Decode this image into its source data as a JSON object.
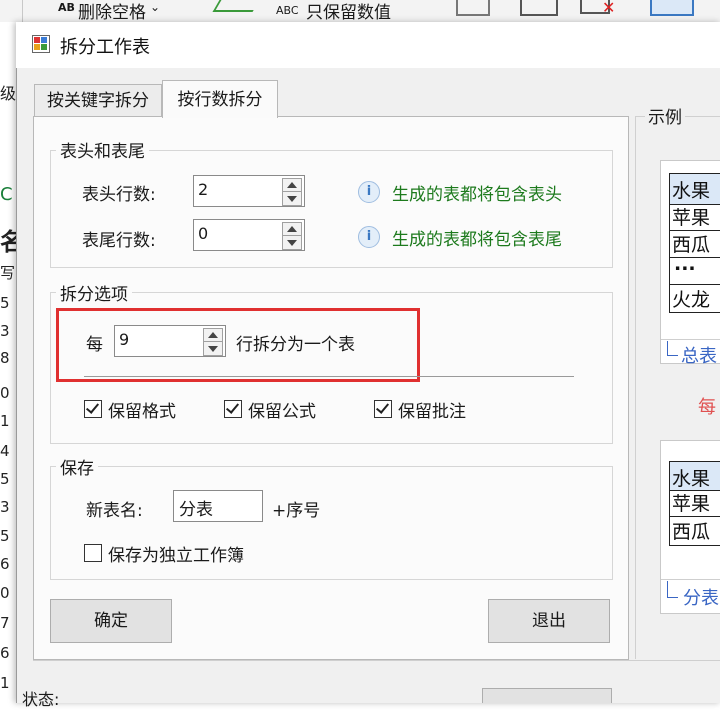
{
  "background": {
    "ribbon": {
      "delete_spaces": "删除空格",
      "keep_values": "只保留数值",
      "ab_prefix": "AB",
      "abc_prefix": "ABC"
    },
    "left_column": [
      "级",
      "C",
      "名",
      "写",
      "5",
      "3",
      "8",
      "0",
      "1",
      "4",
      "5",
      "3",
      "5",
      "6",
      "0",
      "7",
      "6",
      "1"
    ]
  },
  "dialog": {
    "title": "拆分工作表",
    "tabs": [
      {
        "label": "按关键字拆分",
        "active": false
      },
      {
        "label": "按行数拆分",
        "active": true
      }
    ],
    "header_footer": {
      "legend": "表头和表尾",
      "header_rows_label": "表头行数:",
      "header_rows_value": "2",
      "header_info": "生成的表都将包含表头",
      "footer_rows_label": "表尾行数:",
      "footer_rows_value": "0",
      "footer_info": "生成的表都将包含表尾"
    },
    "split_options": {
      "legend": "拆分选项",
      "every_label": "每",
      "rows_value": "9",
      "rows_suffix": "行拆分为一个表",
      "keep_format": {
        "label": "保留格式",
        "checked": true
      },
      "keep_formula": {
        "label": "保留公式",
        "checked": true
      },
      "keep_comments": {
        "label": "保留批注",
        "checked": true
      }
    },
    "save": {
      "legend": "保存",
      "sheet_name_label": "新表名:",
      "sheet_name_value": "分表",
      "sheet_name_suffix": "+序号",
      "independent_workbook": {
        "label": "保存为独立工作簿",
        "checked": false
      }
    },
    "buttons": {
      "ok": "确定",
      "exit": "退出"
    },
    "example": {
      "legend": "示例",
      "top_table": [
        "水果",
        "苹果",
        "西瓜",
        "...",
        "火龙"
      ],
      "top_sheet_tab": "总表",
      "arrow_text": "每",
      "bottom_table": [
        "水果",
        "苹果",
        "西瓜"
      ],
      "bottom_sheet_tab": "分表"
    },
    "status_label": "状态:"
  },
  "colors": {
    "highlight_border": "#e03030",
    "info_text": "#1d7a1d",
    "example_arrow": "#e05050"
  }
}
